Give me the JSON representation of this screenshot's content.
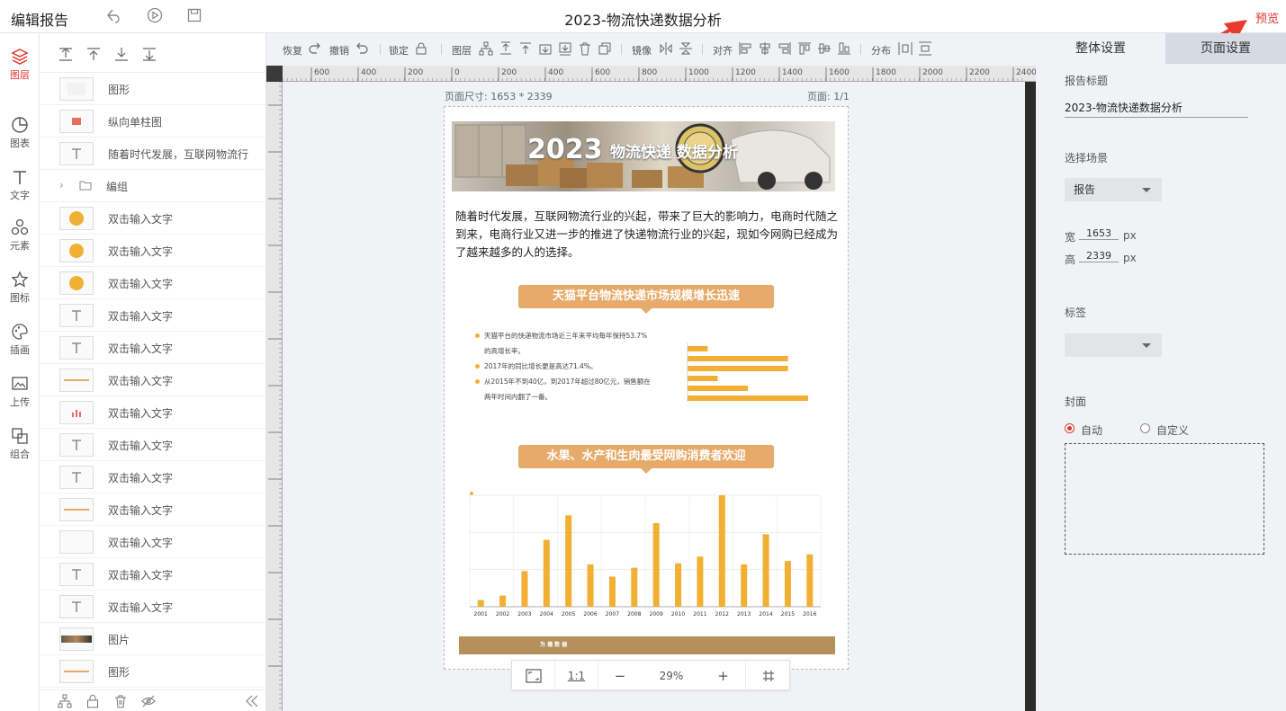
{
  "app": {
    "title": "编辑报告",
    "doc_title": "2023-物流快递数据分析",
    "preview": "预览"
  },
  "nav": [
    {
      "label": "图层",
      "icon": "layers-icon"
    },
    {
      "label": "图表",
      "icon": "pie-chart-icon"
    },
    {
      "label": "文字",
      "icon": "text-icon"
    },
    {
      "label": "元素",
      "icon": "elements-icon"
    },
    {
      "label": "图标",
      "icon": "star-icon"
    },
    {
      "label": "插画",
      "icon": "palette-icon"
    },
    {
      "label": "上传",
      "icon": "upload-image-icon"
    },
    {
      "label": "组合",
      "icon": "group-icon"
    }
  ],
  "layers": [
    {
      "name": "图形",
      "thumb": "shape"
    },
    {
      "name": "纵向单柱图",
      "thumb": "bar"
    },
    {
      "name": "随着时代发展，互联网物流行",
      "thumb": "text"
    },
    {
      "name": "编组",
      "thumb": "group"
    },
    {
      "name": "双击输入文字",
      "thumb": "circle"
    },
    {
      "name": "双击输入文字",
      "thumb": "circle"
    },
    {
      "name": "双击输入文字",
      "thumb": "circle"
    },
    {
      "name": "双击输入文字",
      "thumb": "text"
    },
    {
      "name": "双击输入文字",
      "thumb": "text"
    },
    {
      "name": "双击输入文字",
      "thumb": "line"
    },
    {
      "name": "双击输入文字",
      "thumb": "chart"
    },
    {
      "name": "双击输入文字",
      "thumb": "text"
    },
    {
      "name": "双击输入文字",
      "thumb": "text"
    },
    {
      "name": "双击输入文字",
      "thumb": "line"
    },
    {
      "name": "双击输入文字",
      "thumb": "blank"
    },
    {
      "name": "双击输入文字",
      "thumb": "text"
    },
    {
      "name": "双击输入文字",
      "thumb": "text"
    },
    {
      "name": "图片",
      "thumb": "image"
    },
    {
      "name": "图形",
      "thumb": "line"
    }
  ],
  "toolbar": {
    "redo": "恢复",
    "undo": "撤销",
    "lock": "锁定",
    "layer": "图层",
    "mirror": "镜像",
    "align": "对齐",
    "distribute": "分布"
  },
  "ruler_labels": [
    "600",
    "400",
    "200",
    "0",
    "200",
    "400",
    "600",
    "800",
    "1000",
    "1200",
    "1400",
    "1600",
    "1800",
    "2000",
    "2200",
    "2400"
  ],
  "page_meta": {
    "size": "页面尺寸: 1653 * 2339",
    "pages": "页面: 1/1"
  },
  "poster": {
    "year": "2023",
    "subtitle": "物流快递 数据分析",
    "intro": "随着时代发展，互联网物流行业的兴起，带来了巨大的影响力，电商时代随之到来，电商行业又进一步的推进了快递物流行业的兴起，现如今网购已经成为了越来越多的人的选择。",
    "section1": "天猫平台物流快递市场规模增长迅速",
    "bullets": [
      "天猫平台的快递物流市场近三年来平均每年保持53.7%的高增长率。",
      "2017年的同比增长更是高达71.4%。",
      "从2015年不到40亿，到2017年超过80亿元，销售额在两年时间内翻了一番。"
    ],
    "section2": "水果、水产和生肉最受网购消费者欢迎",
    "footer": "为 播 数 据"
  },
  "chart_data": [
    {
      "type": "bar",
      "orientation": "horizontal",
      "values": [
        10,
        50,
        50,
        15,
        30,
        60
      ]
    },
    {
      "type": "bar",
      "categories": [
        "2001",
        "2002",
        "2003",
        "2004",
        "2005",
        "2006",
        "2007",
        "2008",
        "2009",
        "2010",
        "2011",
        "2012",
        "2013",
        "2014",
        "2015",
        "2016"
      ],
      "values": [
        6,
        10,
        32,
        60,
        82,
        38,
        27,
        35,
        75,
        39,
        45,
        100,
        38,
        65,
        41,
        47
      ]
    }
  ],
  "zoom": {
    "fit": "⛶",
    "one": "1:1",
    "minus": "−",
    "value": "29%",
    "plus": "+",
    "grid": "#"
  },
  "right": {
    "tab_global": "整体设置",
    "tab_page": "页面设置",
    "report_title_label": "报告标题",
    "report_title_value": "2023-物流快递数据分析",
    "scene_label": "选择场景",
    "scene_value": "报告",
    "width_label": "宽",
    "width_value": "1653",
    "height_label": "高",
    "height_value": "2339",
    "unit": "px",
    "tag_label": "标签",
    "tag_value": "",
    "cover_label": "封面",
    "cover_auto": "自动",
    "cover_custom": "自定义"
  },
  "colors": {
    "accent": "#e3342f",
    "bar": "#f1b033",
    "section": "#e6aa6a"
  }
}
